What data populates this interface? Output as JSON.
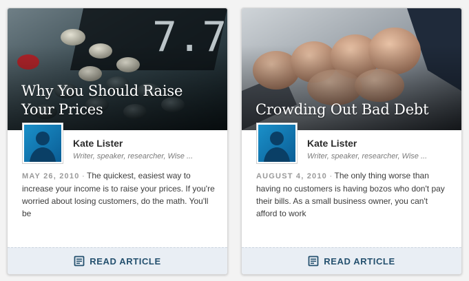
{
  "colors": {
    "page_bg": "#f3f3f3",
    "footer_bg": "#e9eef4",
    "footer_text": "#24506e",
    "avatar_blue": "#1a90c9"
  },
  "cards": [
    {
      "title": "Why You Should Raise Your Prices",
      "hero_image": "cash-register-keys",
      "author_name": "Kate Lister",
      "author_bio": "Writer, speaker, researcher, Wise ...",
      "date": "MAY 26, 2010",
      "separator": "·",
      "excerpt": "The quickest, easiest way to increase your income is to raise your prices. If you're worried about losing customers, do the math. You'll be",
      "read_label": "READ ARTICLE",
      "read_icon": "document-icon"
    },
    {
      "title": "Crowding Out Bad Debt",
      "hero_image": "fist-bump-hands",
      "author_name": "Kate Lister",
      "author_bio": "Writer, speaker, researcher, Wise ...",
      "date": "AUGUST 4, 2010",
      "separator": "·",
      "excerpt": "The only thing worse than having no customers is having bozos who don't pay their bills. As a small business owner, you can't afford to work",
      "read_label": "READ ARTICLE",
      "read_icon": "document-icon"
    }
  ]
}
